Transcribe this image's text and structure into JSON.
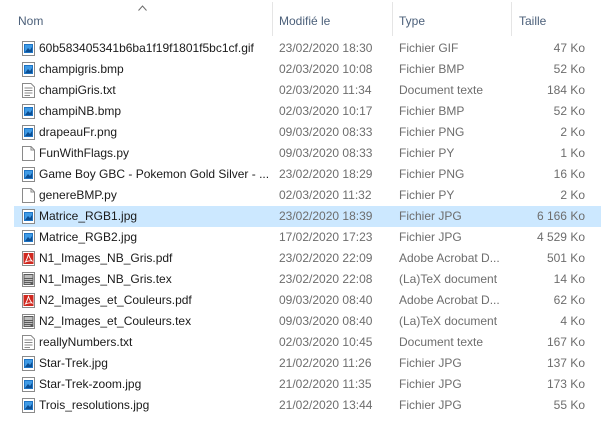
{
  "columns": {
    "name": "Nom",
    "modified": "Modifié le",
    "type": "Type",
    "size": "Taille"
  },
  "colors": {
    "selected_row": "#cce8ff",
    "header_text": "#4c607a",
    "image_icon": "#1e74c4",
    "pdf_icon": "#d0281f"
  },
  "files": [
    {
      "name": "60b583405341b6ba1f19f1801f5bc1cf.gif",
      "modified": "23/02/2020 18:30",
      "type": "Fichier GIF",
      "size": "47 Ko",
      "icon": "image-file-icon",
      "selected": false
    },
    {
      "name": "champigris.bmp",
      "modified": "02/03/2020 10:08",
      "type": "Fichier BMP",
      "size": "52 Ko",
      "icon": "image-file-icon",
      "selected": false
    },
    {
      "name": "champiGris.txt",
      "modified": "02/03/2020 11:34",
      "type": "Document texte",
      "size": "184 Ko",
      "icon": "text-file-icon",
      "selected": false
    },
    {
      "name": "champiNB.bmp",
      "modified": "02/03/2020 10:17",
      "type": "Fichier BMP",
      "size": "52 Ko",
      "icon": "image-file-icon",
      "selected": false
    },
    {
      "name": "drapeauFr.png",
      "modified": "09/03/2020 08:33",
      "type": "Fichier PNG",
      "size": "2 Ko",
      "icon": "image-file-icon",
      "selected": false
    },
    {
      "name": "FunWithFlags.py",
      "modified": "09/03/2020 08:33",
      "type": "Fichier PY",
      "size": "1 Ko",
      "icon": "blank-file-icon",
      "selected": false
    },
    {
      "name": "Game Boy GBC - Pokemon Gold Silver - ...",
      "modified": "23/02/2020 18:29",
      "type": "Fichier PNG",
      "size": "16 Ko",
      "icon": "image-file-icon",
      "selected": false
    },
    {
      "name": "genereBMP.py",
      "modified": "02/03/2020 11:32",
      "type": "Fichier PY",
      "size": "2 Ko",
      "icon": "blank-file-icon",
      "selected": false
    },
    {
      "name": "Matrice_RGB1.jpg",
      "modified": "23/02/2020 18:39",
      "type": "Fichier JPG",
      "size": "6 166 Ko",
      "icon": "image-file-icon",
      "selected": true
    },
    {
      "name": "Matrice_RGB2.jpg",
      "modified": "17/02/2020 17:23",
      "type": "Fichier JPG",
      "size": "4 529 Ko",
      "icon": "image-file-icon",
      "selected": false
    },
    {
      "name": "N1_Images_NB_Gris.pdf",
      "modified": "23/02/2020 22:09",
      "type": "Adobe Acrobat D...",
      "size": "501 Ko",
      "icon": "pdf-file-icon",
      "selected": false
    },
    {
      "name": "N1_Images_NB_Gris.tex",
      "modified": "23/02/2020 22:08",
      "type": "(La)TeX document",
      "size": "14 Ko",
      "icon": "tex-file-icon",
      "selected": false
    },
    {
      "name": "N2_Images_et_Couleurs.pdf",
      "modified": "09/03/2020 08:40",
      "type": "Adobe Acrobat D...",
      "size": "62 Ko",
      "icon": "pdf-file-icon",
      "selected": false
    },
    {
      "name": "N2_Images_et_Couleurs.tex",
      "modified": "09/03/2020 08:40",
      "type": "(La)TeX document",
      "size": "4 Ko",
      "icon": "tex-file-icon",
      "selected": false
    },
    {
      "name": "reallyNumbers.txt",
      "modified": "02/03/2020 10:45",
      "type": "Document texte",
      "size": "167 Ko",
      "icon": "text-file-icon",
      "selected": false
    },
    {
      "name": "Star-Trek.jpg",
      "modified": "21/02/2020 11:26",
      "type": "Fichier JPG",
      "size": "137 Ko",
      "icon": "image-file-icon",
      "selected": false
    },
    {
      "name": "Star-Trek-zoom.jpg",
      "modified": "21/02/2020 11:35",
      "type": "Fichier JPG",
      "size": "173 Ko",
      "icon": "image-file-icon",
      "selected": false
    },
    {
      "name": "Trois_resolutions.jpg",
      "modified": "21/02/2020 13:44",
      "type": "Fichier JPG",
      "size": "55 Ko",
      "icon": "image-file-icon",
      "selected": false
    }
  ]
}
